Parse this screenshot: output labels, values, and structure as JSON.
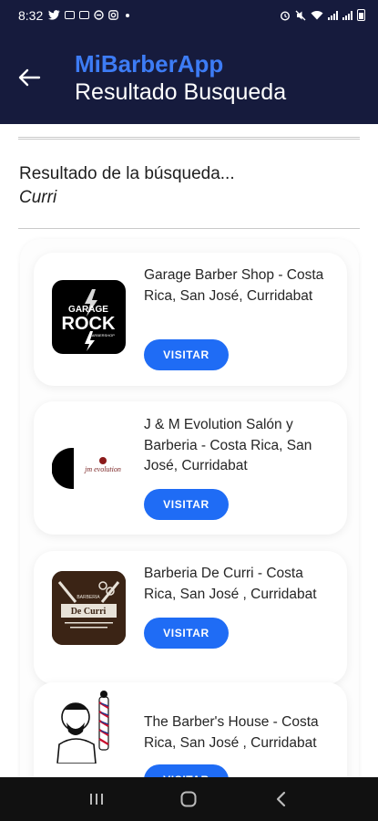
{
  "status_bar": {
    "time": "8:32",
    "left_icons": [
      "twitter-icon",
      "mail-icon",
      "ticket-icon",
      "dnd-icon",
      "instagram-icon",
      "dot-icon"
    ],
    "right_icons": [
      "alarm-icon",
      "mute-icon",
      "wifi-icon",
      "signal-icon",
      "signal-icon",
      "battery-icon"
    ]
  },
  "app_bar": {
    "app_name": "MiBarberApp",
    "page_title": "Resultado Busqueda",
    "back_icon": "arrow-left-icon"
  },
  "search": {
    "heading": "Resultado de la búsqueda...",
    "query": "Curri"
  },
  "results": [
    {
      "name": "Garage Barber Shop - Costa Rica, San José, Curridabat",
      "button_label": "VISITAR",
      "logo": {
        "line1": "GARAGE",
        "line2": "ROCK",
        "line3": "BARBERSHOP",
        "bg": "#000000"
      }
    },
    {
      "name": "J & M Evolution Salón y Barberia - Costa Rica, San José, Curridabat",
      "button_label": "VISITAR",
      "logo": {
        "text": "jm evolution"
      }
    },
    {
      "name": "Barberia De Curri - Costa Rica, San José , Curridabat",
      "button_label": "VISITAR",
      "logo": {
        "line1": "BARBERIA",
        "line2": "De Curri"
      }
    },
    {
      "name": "The Barber's House - Costa Rica, San José , Curridabat",
      "button_label": "VISITAR",
      "logo": {}
    }
  ],
  "nav_bar": {
    "icons": [
      "recent-apps-icon",
      "home-icon",
      "back-icon"
    ]
  },
  "colors": {
    "header_bg": "#161b3d",
    "accent": "#3d7cf5",
    "button": "#1f6cf5"
  }
}
